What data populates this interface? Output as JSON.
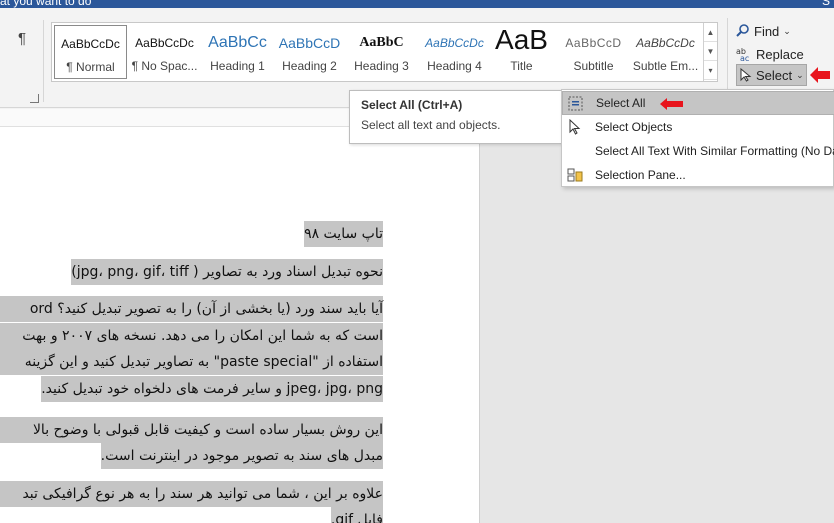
{
  "titlebar": {
    "tell_me": "at you want to do",
    "share": "S"
  },
  "paragraph": {
    "pilcrow": "¶"
  },
  "styles": [
    {
      "preview": "AaBbCcDc",
      "name": "¶ Normal",
      "kind": "normal"
    },
    {
      "preview": "AaBbCcDc",
      "name": "¶ No Spac...",
      "kind": "normal"
    },
    {
      "preview": "AaBbCc",
      "name": "Heading 1",
      "kind": "h1"
    },
    {
      "preview": "AaBbCcD",
      "name": "Heading 2",
      "kind": "h2"
    },
    {
      "preview": "AaBbC",
      "name": "Heading 3",
      "kind": "h3"
    },
    {
      "preview": "AaBbCcDc",
      "name": "Heading 4",
      "kind": "h4"
    },
    {
      "preview": "AaB",
      "name": "Title",
      "kind": "title"
    },
    {
      "preview": "AaBbCcD",
      "name": "Subtitle",
      "kind": "subtitle"
    },
    {
      "preview": "AaBbCcDc",
      "name": "Subtle Em...",
      "kind": "subtle"
    }
  ],
  "editing": {
    "find_label": "Find",
    "replace_label": "Replace",
    "select_label": "Select"
  },
  "tooltip": {
    "title": "Select All (Ctrl+A)",
    "description": "Select all text and objects."
  },
  "select_menu": [
    {
      "label": "Select All",
      "icon": "select-all-icon",
      "highlighted": true
    },
    {
      "label": "Select Objects",
      "icon": "pointer-icon",
      "highlighted": false
    },
    {
      "label": "Select All Text With Similar Formatting (No Da",
      "icon": "",
      "highlighted": false
    },
    {
      "label": "Selection Pane...",
      "icon": "selection-pane-icon",
      "highlighted": false
    }
  ],
  "document": {
    "lines": [
      "تاپ سایت ۹۸",
      "نحوه تبدیل اسناد ورد به تصاویر ( jpg، png، gif، tiff)",
      "آیا باید سند ورد (یا بخشی از آن) را به تصویر تبدیل کنید؟ ord",
      "است که به شما این امکان را می دهد. نسخه های ۲۰۰۷ و بهت",
      "استفاده از \"paste special\" به تصاویر تبدیل کنید و این گزینه",
      "jpeg، jpg، png و سایر فرمت های دلخواه خود تبدیل کنید.",
      "این روش بسیار ساده است و کیفیت قابل قبولی با وضوح بالا",
      "مبدل های سند به تصویر موجود در اینترنت است.",
      "علاوه بر این ، شما می توانید هر سند را به هر نوع گرافیکی تبد",
      "فایل gif."
    ]
  },
  "colors": {
    "accent": "#2b579a",
    "selection_highlight": "#c5c5c5",
    "annotation_arrow": "#e8141c"
  }
}
